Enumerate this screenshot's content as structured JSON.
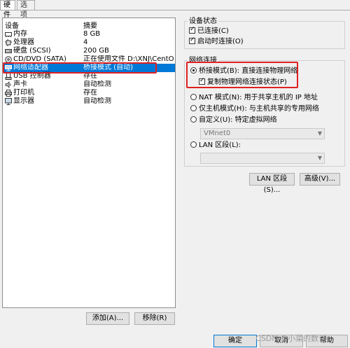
{
  "tabs": [
    {
      "label": "硬件"
    },
    {
      "label": "选项"
    }
  ],
  "device_list": {
    "headers": {
      "device": "设备",
      "summary": "摘要"
    },
    "rows": [
      {
        "name": "内存",
        "summary": "8 GB",
        "icon": "memory-icon"
      },
      {
        "name": "处理器",
        "summary": "4",
        "icon": "cpu-icon"
      },
      {
        "name": "硬盘 (SCSI)",
        "summary": "200 GB",
        "icon": "disk-icon"
      },
      {
        "name": "CD/DVD (SATA)",
        "summary": "正在使用文件 D:\\XNJ\\CentOS-...",
        "icon": "cd-icon"
      },
      {
        "name": "网络适配器",
        "summary": "桥接模式 (自动)",
        "icon": "network-icon",
        "selected": true
      },
      {
        "name": "USB 控制器",
        "summary": "存在",
        "icon": "usb-icon"
      },
      {
        "name": "声卡",
        "summary": "自动检测",
        "icon": "sound-icon"
      },
      {
        "name": "打印机",
        "summary": "存在",
        "icon": "printer-icon"
      },
      {
        "name": "显示器",
        "summary": "自动检测",
        "icon": "monitor-icon"
      }
    ]
  },
  "device_status": {
    "title": "设备状态",
    "connected": "已连接(C)",
    "connect_on_power": "启动时连接(O)"
  },
  "network": {
    "title": "网络连接",
    "bridged": "桥接模式(B): 直接连接物理网络",
    "replicate": "复制物理网络连接状态(P)",
    "nat": "NAT 模式(N): 用于共享主机的 IP 地址",
    "host_only": "仅主机模式(H): 与主机共享的专用网络",
    "custom": "自定义(U): 特定虚拟网络",
    "custom_select": "VMnet0",
    "lan": "LAN 区段(L):",
    "lan_select": ""
  },
  "buttons": {
    "lan_segments": "LAN 区段(S)...",
    "advanced": "高级(V)...",
    "add": "添加(A)...",
    "remove": "移除(R)",
    "ok": "确定",
    "cancel": "取消",
    "help": "帮助"
  },
  "watermark": "CSDN @小菜的数记"
}
